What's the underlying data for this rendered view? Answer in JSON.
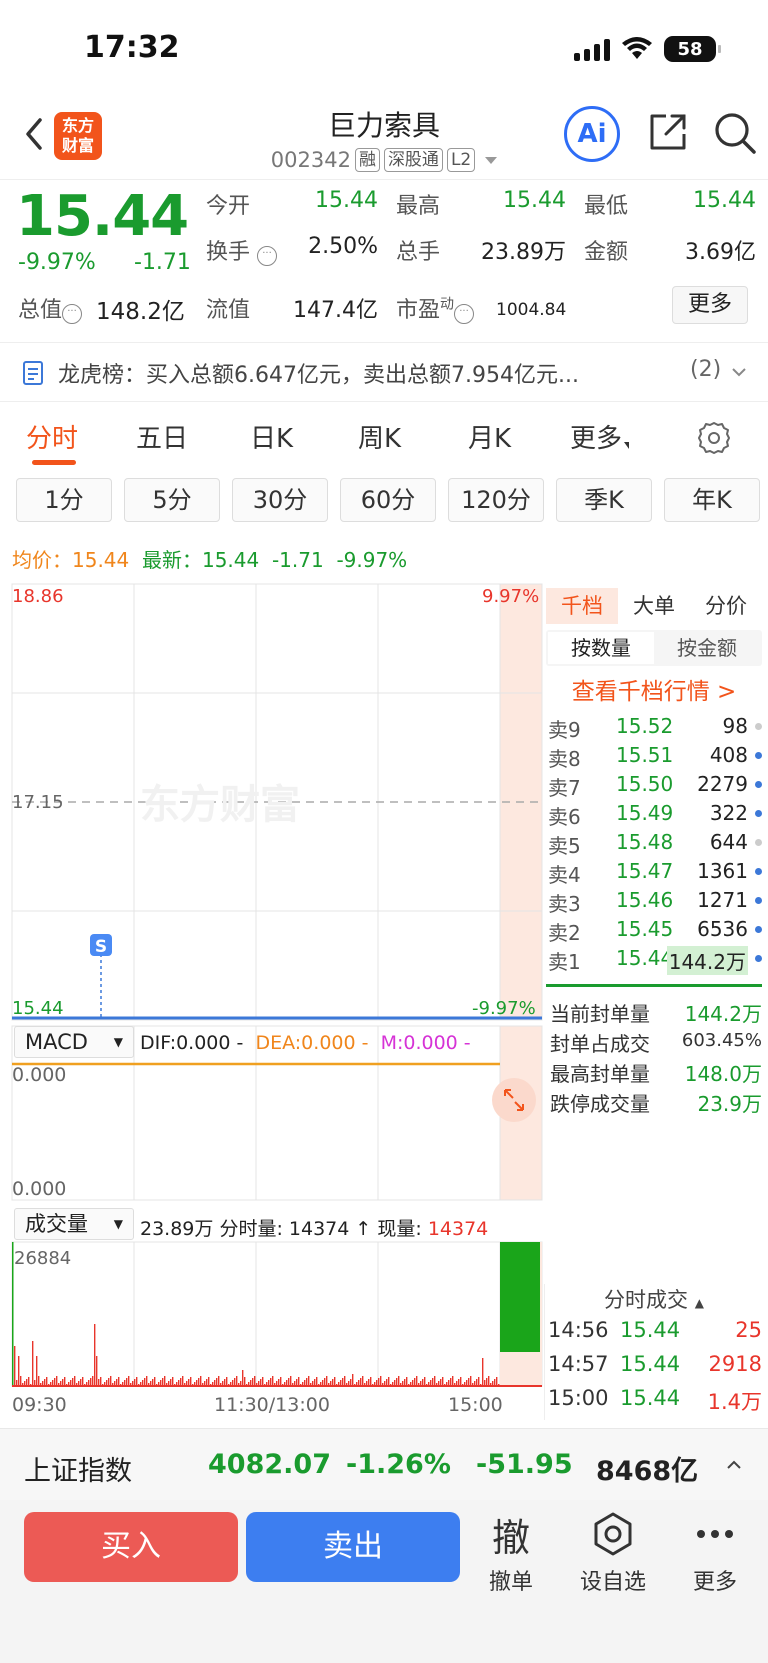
{
  "status": {
    "time": "17:32",
    "battery": "58"
  },
  "header": {
    "logo": "东方\n财富",
    "name": "巨力索具",
    "code": "002342",
    "tags": [
      "融",
      "深股通",
      "L2"
    ],
    "ai": "Ai"
  },
  "quote": {
    "price": "15.44",
    "change_pct": "-9.97%",
    "change_val": "-1.71",
    "open_label": "今开",
    "open": "15.44",
    "high_label": "最高",
    "high": "15.44",
    "low_label": "最低",
    "low": "15.44",
    "turnover_label": "换手",
    "turnover": "2.50%",
    "volume_label": "总手",
    "volume": "23.89万",
    "amount_label": "金额",
    "amount": "3.69亿",
    "mktcap_label": "总值",
    "mktcap": "148.2亿",
    "float_label": "流值",
    "float": "147.4亿",
    "pe_label": "市盈",
    "pe_sup": "动",
    "pe": "1004.84",
    "more": "更多"
  },
  "lhb": {
    "text": "龙虎榜：买入总额6.647亿元，卖出总额7.954亿元...",
    "count": "(2)"
  },
  "tabs": [
    {
      "label": "分时"
    },
    {
      "label": "五日"
    },
    {
      "label": "日K"
    },
    {
      "label": "周K"
    },
    {
      "label": "月K"
    },
    {
      "label": "更多"
    }
  ],
  "subtabs": [
    "1分",
    "5分",
    "30分",
    "60分",
    "120分",
    "季K",
    "年K"
  ],
  "avgline": {
    "avg_label": "均价：",
    "avg": "15.44",
    "last_label": "最新：",
    "last": "15.44",
    "chg": "-1.71",
    "pct": "-9.97%"
  },
  "chart": {
    "top_price": "18.86",
    "mid_price": "17.15",
    "bottom_price": "15.44",
    "top_pct": "9.97%",
    "bottom_pct": "-9.97%",
    "watermark": "东方财富",
    "s_marker": "S"
  },
  "macd": {
    "title": "MACD",
    "dif": "DIF:0.000 -",
    "dea": "DEA:0.000 -",
    "m": "M:0.000 -",
    "top": "0.000",
    "bottom": "0.000"
  },
  "volume_panel": {
    "title": "成交量",
    "total": "23.89万",
    "fs_label": "分时量:",
    "fs": "14374",
    "arrow": "↑",
    "now_label": "现量:",
    "now": "14374",
    "max": "26884",
    "times": [
      "09:30",
      "11:30/13:00",
      "15:00"
    ]
  },
  "orderbook": {
    "tabs": [
      "千档",
      "大单",
      "分价"
    ],
    "subtabs": [
      "按数量",
      "按金额"
    ],
    "link": "查看千档行情 >",
    "rows": [
      {
        "label": "卖9",
        "price": "15.52",
        "vol": "98",
        "dot": "grey"
      },
      {
        "label": "卖8",
        "price": "15.51",
        "vol": "408",
        "dot": "blue"
      },
      {
        "label": "卖7",
        "price": "15.50",
        "vol": "2279",
        "dot": "blue"
      },
      {
        "label": "卖6",
        "price": "15.49",
        "vol": "322",
        "dot": "blue"
      },
      {
        "label": "卖5",
        "price": "15.48",
        "vol": "644",
        "dot": "grey"
      },
      {
        "label": "卖4",
        "price": "15.47",
        "vol": "1361",
        "dot": "blue"
      },
      {
        "label": "卖3",
        "price": "15.46",
        "vol": "1271",
        "dot": "blue"
      },
      {
        "label": "卖2",
        "price": "15.45",
        "vol": "6536",
        "dot": "blue"
      },
      {
        "label": "卖1",
        "price": "15.44",
        "vol": "144.2万",
        "dot": "blue"
      }
    ],
    "seal": [
      {
        "label": "当前封单量",
        "value": "144.2万"
      },
      {
        "label": "封单占成交",
        "value": "603.45%"
      },
      {
        "label": "最高封单量",
        "value": "148.0万"
      },
      {
        "label": "跌停成交量",
        "value": "23.9万"
      }
    ]
  },
  "ticks": {
    "title": "分时成交",
    "rows": [
      {
        "time": "14:56",
        "price": "15.44",
        "vol": "25"
      },
      {
        "time": "14:57",
        "price": "15.44",
        "vol": "2918"
      },
      {
        "time": "15:00",
        "price": "15.44",
        "vol": "1.4万"
      }
    ]
  },
  "index_bar": {
    "name": "上证指数",
    "value": "4082.07",
    "pct": "-1.26%",
    "chg": "-51.95",
    "amount": "8468亿"
  },
  "actions": {
    "buy": "买入",
    "sell": "卖出",
    "cancel_icon": "撤",
    "cancel": "撤单",
    "watch": "设自选",
    "more": "更多"
  }
}
